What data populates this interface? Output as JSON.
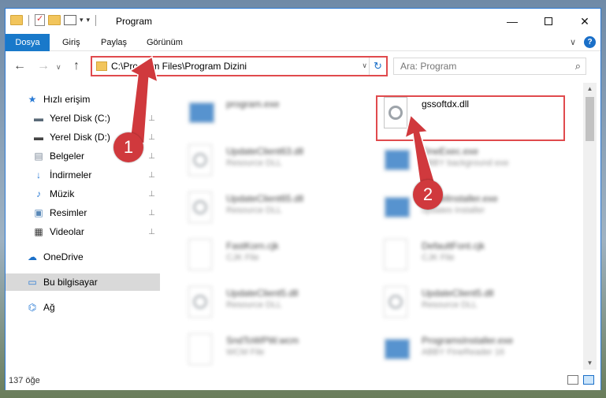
{
  "window": {
    "title": "Program",
    "controls": {
      "minimize": "—",
      "maximize": "",
      "close": "✕"
    }
  },
  "ribbon": {
    "tabs": [
      "Dosya",
      "Giriş",
      "Paylaş",
      "Görünüm"
    ],
    "active_tab": "Dosya",
    "collapse_glyph": "∨",
    "help_glyph": "?"
  },
  "nav": {
    "back_glyph": "←",
    "forward_glyph": "→",
    "history_glyph": "∨",
    "up_glyph": "↑",
    "address": "C:\\Program Files\\Program Dizini",
    "address_dd_glyph": "∨",
    "refresh_glyph": "↻",
    "search_placeholder": "Ara: Program",
    "search_glyph": "⌕"
  },
  "sidebar": {
    "items": [
      {
        "label": "Hızlı erişim",
        "icon": "star-icon",
        "glyph": "★",
        "color": "#2a7bd5",
        "pinned": false,
        "selected": false
      },
      {
        "label": "Yerel Disk (C:)",
        "icon": "drive-icon",
        "glyph": "▬",
        "color": "#5a6a78",
        "pinned": true,
        "selected": false
      },
      {
        "label": "Yerel Disk (D:)",
        "icon": "drive-icon",
        "glyph": "▬",
        "color": "#444444",
        "pinned": true,
        "selected": false
      },
      {
        "label": "Belgeler",
        "icon": "documents-icon",
        "glyph": "▤",
        "color": "#7d8a99",
        "pinned": true,
        "selected": false
      },
      {
        "label": "İndirmeler",
        "icon": "download-icon",
        "glyph": "↓",
        "color": "#2a7bd5",
        "pinned": true,
        "selected": false
      },
      {
        "label": "Müzik",
        "icon": "music-icon",
        "glyph": "♪",
        "color": "#2a7bd5",
        "pinned": true,
        "selected": false
      },
      {
        "label": "Resimler",
        "icon": "pictures-icon",
        "glyph": "▣",
        "color": "#5a89b8",
        "pinned": true,
        "selected": false
      },
      {
        "label": "Videolar",
        "icon": "videos-icon",
        "glyph": "▦",
        "color": "#333333",
        "pinned": true,
        "selected": false
      },
      {
        "label": "OneDrive",
        "icon": "cloud-icon",
        "glyph": "☁",
        "color": "#1a6fc8",
        "pinned": false,
        "selected": false
      },
      {
        "label": "Bu bilgisayar",
        "icon": "computer-icon",
        "glyph": "▭",
        "color": "#2a7bd5",
        "pinned": false,
        "selected": true
      },
      {
        "label": "Ağ",
        "icon": "network-icon",
        "glyph": "⌬",
        "color": "#2a7bd5",
        "pinned": false,
        "selected": false
      }
    ],
    "pin_glyph": "📌"
  },
  "files": [
    {
      "name": "program.exe",
      "desc": "",
      "type": "exe",
      "blurred": true
    },
    {
      "name": "gssoftdx.dll",
      "desc": "",
      "type": "dll",
      "blurred": false
    },
    {
      "name": "UpdateClient63.dll",
      "desc": "Resource DLL",
      "type": "dll",
      "blurred": true
    },
    {
      "name": "OneExec.exe",
      "desc": "ABBY background exe",
      "type": "exe",
      "blurred": true
    },
    {
      "name": "UpdateClient65.dll",
      "desc": "Resource DLL",
      "type": "dll",
      "blurred": true
    },
    {
      "name": "ModelInstaller.exe",
      "desc": "updates installer",
      "type": "exe",
      "blurred": true
    },
    {
      "name": "FastKorn.cjk",
      "desc": "CJK File",
      "type": "doc",
      "blurred": true
    },
    {
      "name": "DefaultFont.cjk",
      "desc": "CJK File",
      "type": "doc",
      "blurred": true
    },
    {
      "name": "UpdateClient5.dll",
      "desc": "Resource DLL",
      "type": "dll",
      "blurred": true
    },
    {
      "name": "UpdateClient5.dll",
      "desc": "Resource DLL",
      "type": "dll",
      "blurred": true
    },
    {
      "name": "SndToWPW.wcm",
      "desc": "WCM File",
      "type": "doc",
      "blurred": true
    },
    {
      "name": "ProgramsInstaller.exe",
      "desc": "ABBY FineReader 16",
      "type": "exe",
      "blurred": true
    }
  ],
  "status": {
    "item_count": "137 öğe"
  },
  "annotations": [
    {
      "label": "1"
    },
    {
      "label": "2"
    }
  ],
  "colors": {
    "accent": "#1979ca",
    "annotation_red": "#d0393d",
    "highlight_border": "#e04a4d"
  }
}
